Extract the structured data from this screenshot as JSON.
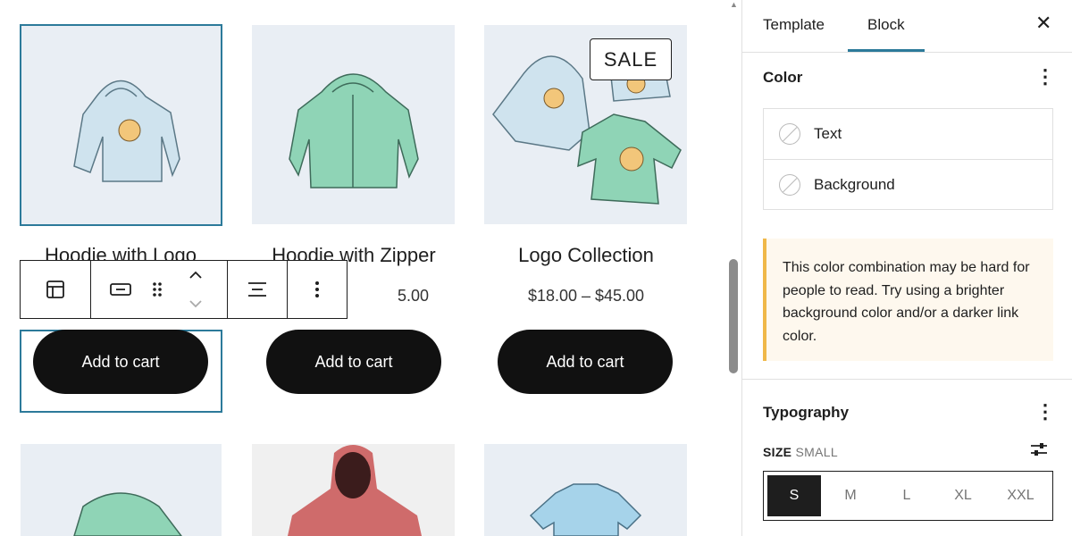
{
  "products": [
    {
      "title": "Hoodie with Logo",
      "price": "",
      "button": "Add to cart"
    },
    {
      "title": "Hoodie with Zipper",
      "price": "5.00",
      "button": "Add to cart"
    },
    {
      "title": "Logo Collection",
      "price": "$18.00 – $45.00",
      "button": "Add to cart",
      "badge": "SALE"
    }
  ],
  "sidebar": {
    "tabs": [
      "Template",
      "Block"
    ],
    "active_tab": "Block",
    "close_icon": "✕",
    "color": {
      "title": "Color",
      "items": [
        "Text",
        "Background"
      ],
      "notice": "This color combination may be hard for people to read. Try using a brighter background color and/or a darker link color."
    },
    "typography": {
      "title": "Typography",
      "size_label": "SIZE",
      "size_value": "SMALL",
      "sizes": [
        "S",
        "M",
        "L",
        "XL",
        "XXL"
      ],
      "selected_size": "S"
    }
  },
  "colors": {
    "accent": "#2c7a9a",
    "button": "#111111",
    "notice_border": "#f0b849",
    "notice_bg": "#fef8ee"
  },
  "icons": [
    "layout-icon",
    "button-block-icon",
    "drag-handle-icon",
    "move-up-icon",
    "move-down-icon",
    "justify-icon",
    "more-options-icon",
    "close-icon",
    "typography-settings-icon"
  ]
}
